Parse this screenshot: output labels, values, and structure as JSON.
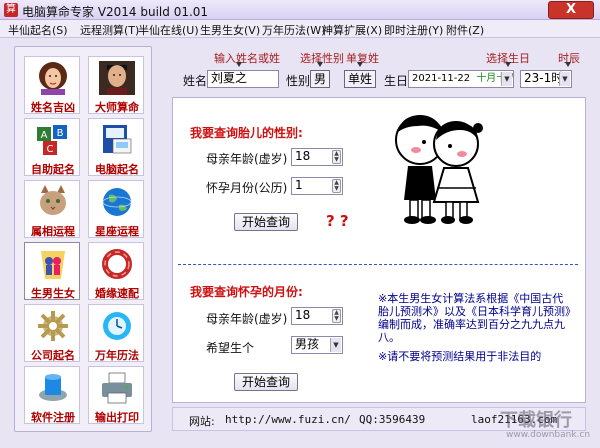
{
  "window": {
    "title": "电脑算命专家  V2014 build 01.01",
    "close_label": "X"
  },
  "menu": [
    "半仙起名(S)",
    "远程测算(T)",
    "半仙在线(U)",
    "生男生女(V)",
    "万年历法(W)",
    "神算扩展(X)",
    "即时注册(Y)",
    "附件(Z)"
  ],
  "sidebar": [
    {
      "label": "姓名吉凶",
      "icon": "woman-portrait-icon"
    },
    {
      "label": "大师算命",
      "icon": "master-portrait-icon"
    },
    {
      "label": "自助起名",
      "icon": "letter-blocks-icon"
    },
    {
      "label": "电脑起名",
      "icon": "computer-book-icon"
    },
    {
      "label": "属相运程",
      "icon": "cat-icon"
    },
    {
      "label": "星座运程",
      "icon": "globe-icon"
    },
    {
      "label": "生男生女",
      "icon": "boy-girl-icon"
    },
    {
      "label": "婚缘速配",
      "icon": "red-ring-icon"
    },
    {
      "label": "公司起名",
      "icon": "gear-icon"
    },
    {
      "label": "万年历法",
      "icon": "calendar-icon"
    },
    {
      "label": "软件注册",
      "icon": "disk-icon"
    },
    {
      "label": "输出打印",
      "icon": "printer-icon"
    }
  ],
  "top_form": {
    "hint_name": "输入姓名或姓",
    "hint_gender": "选择性别",
    "hint_single": "单复姓",
    "hint_date": "选择生日",
    "hint_time": "时辰",
    "name_label": "姓名",
    "name_value": "刘夏之",
    "gender_label": "性别",
    "gender_value": "男",
    "single_value": "单姓",
    "birthday_label": "生日",
    "date_value": "2021-11-22",
    "lunar_value": "十月十八",
    "time_value": "23-1时"
  },
  "section1": {
    "title": "我要查询胎儿的性别:",
    "age_label": "母亲年龄(虚岁)",
    "age_value": "18",
    "month_label": "怀孕月份(公历)",
    "month_value": "1",
    "button": "开始查询",
    "result": "? ?"
  },
  "section2": {
    "title": "我要查询怀孕的月份:",
    "age_label": "母亲年龄(虚岁)",
    "age_value": "18",
    "want_label": "希望生个",
    "want_value": "男孩",
    "button": "开始查询",
    "note1": "※本生男生女计算法系根据《中国古代胎儿预测术》以及《日本科学育儿预测》编制而成，准确率达到百分之九九点九八。",
    "note2": "※请不要将预测结果用于非法目的"
  },
  "footer": {
    "site_label": "网站:",
    "site_url": "http://www.fuzi.cn/",
    "qq": "QQ:3596439",
    "mail": "lao⁠f21⁠163.com"
  },
  "watermark": {
    "text": "下载银行",
    "url": "www.downbank.cn"
  },
  "colors": {
    "accent_red": "#d01010",
    "link_blue": "#2a2aa8",
    "note_blue": "#00008b"
  }
}
